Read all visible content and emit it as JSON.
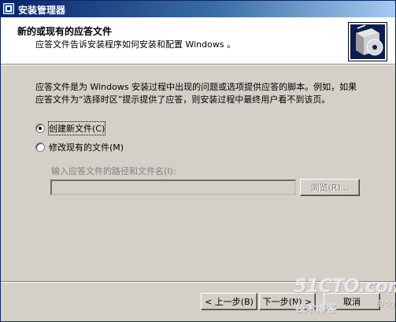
{
  "window": {
    "title": "安装管理器"
  },
  "header": {
    "title": "新的或现有的应答文件",
    "subtitle": "应答文件告诉安装程序如何安装和配置 Windows 。"
  },
  "content": {
    "description": "应答文件是为 Windows 安装过程中出现的问题或选项提供应答的脚本。例如，如果应答文件为“选择时区”提示提供了应答，则安装过程中最终用户看不到该页。",
    "options": [
      {
        "label": "创建新文件(C)",
        "checked": true
      },
      {
        "label": "修改现有的文件(M)",
        "checked": false
      }
    ],
    "path_label": "输入应答文件的路径和文件名(I):",
    "path_value": "",
    "browse_label": "浏览(R)..."
  },
  "footer": {
    "back_label": "< 上一步(B)",
    "next_label": "下一步(N) >",
    "cancel_label": "取消"
  },
  "watermark": {
    "main": "51CTO.com",
    "sub": "技术博客",
    "blog": "Blog"
  },
  "colors": {
    "titlebar_start": "#0a246a",
    "titlebar_end": "#a6caf0",
    "face": "#d4d0c8"
  }
}
